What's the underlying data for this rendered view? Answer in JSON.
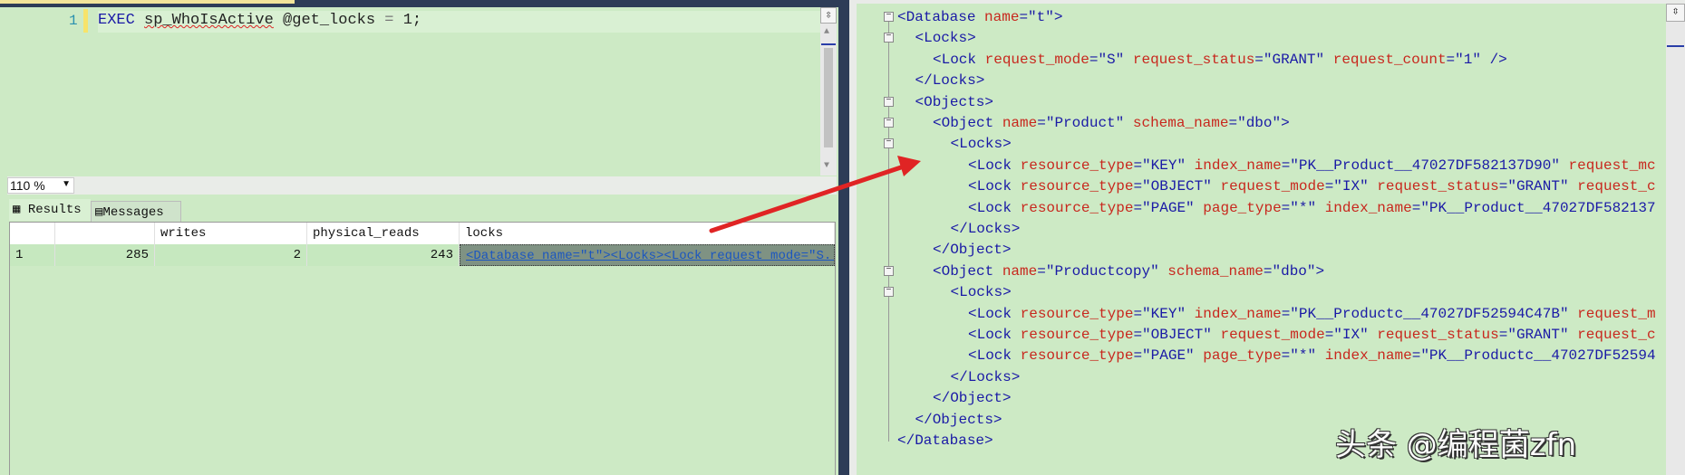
{
  "editor": {
    "line_number": "1",
    "code": {
      "kw": "EXEC",
      "proc": "sp_WhoIsActive",
      "param": "@get_locks",
      "op": "=",
      "val": "1;"
    },
    "zoom": "110 %"
  },
  "results": {
    "tabs": [
      "Results",
      "Messages"
    ],
    "columns": [
      "",
      "",
      "writes",
      "physical_reads",
      "locks"
    ],
    "rows": [
      [
        "1",
        "285",
        "2",
        "243",
        "<Database name=\"t\"><Locks><Lock request_mode=\"S..."
      ]
    ]
  },
  "xml_viewer": {
    "lines": [
      {
        "indent": 0,
        "fold": true,
        "tokens": [
          [
            "t",
            "<Database"
          ],
          [
            "a",
            " name"
          ],
          [
            "p",
            "="
          ],
          [
            "v",
            "\"t\""
          ],
          [
            "t",
            ">"
          ]
        ]
      },
      {
        "indent": 1,
        "fold": true,
        "tokens": [
          [
            "t",
            "<Locks>"
          ]
        ]
      },
      {
        "indent": 2,
        "fold": false,
        "tokens": [
          [
            "t",
            "<Lock"
          ],
          [
            "a",
            " request_mode"
          ],
          [
            "p",
            "="
          ],
          [
            "v",
            "\"S\""
          ],
          [
            "a",
            " request_status"
          ],
          [
            "p",
            "="
          ],
          [
            "v",
            "\"GRANT\""
          ],
          [
            "a",
            " request_count"
          ],
          [
            "p",
            "="
          ],
          [
            "v",
            "\"1\""
          ],
          [
            "t",
            " />"
          ]
        ]
      },
      {
        "indent": 1,
        "fold": false,
        "tokens": [
          [
            "t",
            "</Locks>"
          ]
        ]
      },
      {
        "indent": 1,
        "fold": true,
        "tokens": [
          [
            "t",
            "<Objects>"
          ]
        ]
      },
      {
        "indent": 2,
        "fold": true,
        "tokens": [
          [
            "t",
            "<Object"
          ],
          [
            "a",
            " name"
          ],
          [
            "p",
            "="
          ],
          [
            "v",
            "\"Product\""
          ],
          [
            "a",
            " schema_name"
          ],
          [
            "p",
            "="
          ],
          [
            "v",
            "\"dbo\""
          ],
          [
            "t",
            ">"
          ]
        ]
      },
      {
        "indent": 3,
        "fold": true,
        "tokens": [
          [
            "t",
            "<Locks>"
          ]
        ]
      },
      {
        "indent": 4,
        "fold": false,
        "tokens": [
          [
            "t",
            "<Lock"
          ],
          [
            "a",
            " resource_type"
          ],
          [
            "p",
            "="
          ],
          [
            "v",
            "\"KEY\""
          ],
          [
            "a",
            " index_name"
          ],
          [
            "p",
            "="
          ],
          [
            "v",
            "\"PK__Product__47027DF582137D90\""
          ],
          [
            "a",
            " request_mc"
          ]
        ]
      },
      {
        "indent": 4,
        "fold": false,
        "tokens": [
          [
            "t",
            "<Lock"
          ],
          [
            "a",
            " resource_type"
          ],
          [
            "p",
            "="
          ],
          [
            "v",
            "\"OBJECT\""
          ],
          [
            "a",
            " request_mode"
          ],
          [
            "p",
            "="
          ],
          [
            "v",
            "\"IX\""
          ],
          [
            "a",
            " request_status"
          ],
          [
            "p",
            "="
          ],
          [
            "v",
            "\"GRANT\""
          ],
          [
            "a",
            " request_c"
          ]
        ]
      },
      {
        "indent": 4,
        "fold": false,
        "tokens": [
          [
            "t",
            "<Lock"
          ],
          [
            "a",
            " resource_type"
          ],
          [
            "p",
            "="
          ],
          [
            "v",
            "\"PAGE\""
          ],
          [
            "a",
            " page_type"
          ],
          [
            "p",
            "="
          ],
          [
            "v",
            "\"*\""
          ],
          [
            "a",
            " index_name"
          ],
          [
            "p",
            "="
          ],
          [
            "v",
            "\"PK__Product__47027DF582137"
          ]
        ]
      },
      {
        "indent": 3,
        "fold": false,
        "tokens": [
          [
            "t",
            "</Locks>"
          ]
        ]
      },
      {
        "indent": 2,
        "fold": false,
        "tokens": [
          [
            "t",
            "</Object>"
          ]
        ]
      },
      {
        "indent": 2,
        "fold": true,
        "tokens": [
          [
            "t",
            "<Object"
          ],
          [
            "a",
            " name"
          ],
          [
            "p",
            "="
          ],
          [
            "v",
            "\"Productcopy\""
          ],
          [
            "a",
            " schema_name"
          ],
          [
            "p",
            "="
          ],
          [
            "v",
            "\"dbo\""
          ],
          [
            "t",
            ">"
          ]
        ]
      },
      {
        "indent": 3,
        "fold": true,
        "tokens": [
          [
            "t",
            "<Locks>"
          ]
        ]
      },
      {
        "indent": 4,
        "fold": false,
        "tokens": [
          [
            "t",
            "<Lock"
          ],
          [
            "a",
            " resource_type"
          ],
          [
            "p",
            "="
          ],
          [
            "v",
            "\"KEY\""
          ],
          [
            "a",
            " index_name"
          ],
          [
            "p",
            "="
          ],
          [
            "v",
            "\"PK__Productc__47027DF52594C47B\""
          ],
          [
            "a",
            " request_m"
          ]
        ]
      },
      {
        "indent": 4,
        "fold": false,
        "tokens": [
          [
            "t",
            "<Lock"
          ],
          [
            "a",
            " resource_type"
          ],
          [
            "p",
            "="
          ],
          [
            "v",
            "\"OBJECT\""
          ],
          [
            "a",
            " request_mode"
          ],
          [
            "p",
            "="
          ],
          [
            "v",
            "\"IX\""
          ],
          [
            "a",
            " request_status"
          ],
          [
            "p",
            "="
          ],
          [
            "v",
            "\"GRANT\""
          ],
          [
            "a",
            " request_c"
          ]
        ]
      },
      {
        "indent": 4,
        "fold": false,
        "tokens": [
          [
            "t",
            "<Lock"
          ],
          [
            "a",
            " resource_type"
          ],
          [
            "p",
            "="
          ],
          [
            "v",
            "\"PAGE\""
          ],
          [
            "a",
            " page_type"
          ],
          [
            "p",
            "="
          ],
          [
            "v",
            "\"*\""
          ],
          [
            "a",
            " index_name"
          ],
          [
            "p",
            "="
          ],
          [
            "v",
            "\"PK__Productc__47027DF52594"
          ]
        ]
      },
      {
        "indent": 3,
        "fold": false,
        "tokens": [
          [
            "t",
            "</Locks>"
          ]
        ]
      },
      {
        "indent": 2,
        "fold": false,
        "tokens": [
          [
            "t",
            "</Object>"
          ]
        ]
      },
      {
        "indent": 1,
        "fold": false,
        "tokens": [
          [
            "t",
            "</Objects>"
          ]
        ]
      },
      {
        "indent": 0,
        "fold": false,
        "tokens": [
          [
            "t",
            "</Database>"
          ]
        ]
      }
    ]
  },
  "watermark": "头条 @编程菌zfn",
  "colors": {
    "background": "#cdeac5",
    "arrow": "#e02424",
    "frame": "#2d3c57"
  }
}
